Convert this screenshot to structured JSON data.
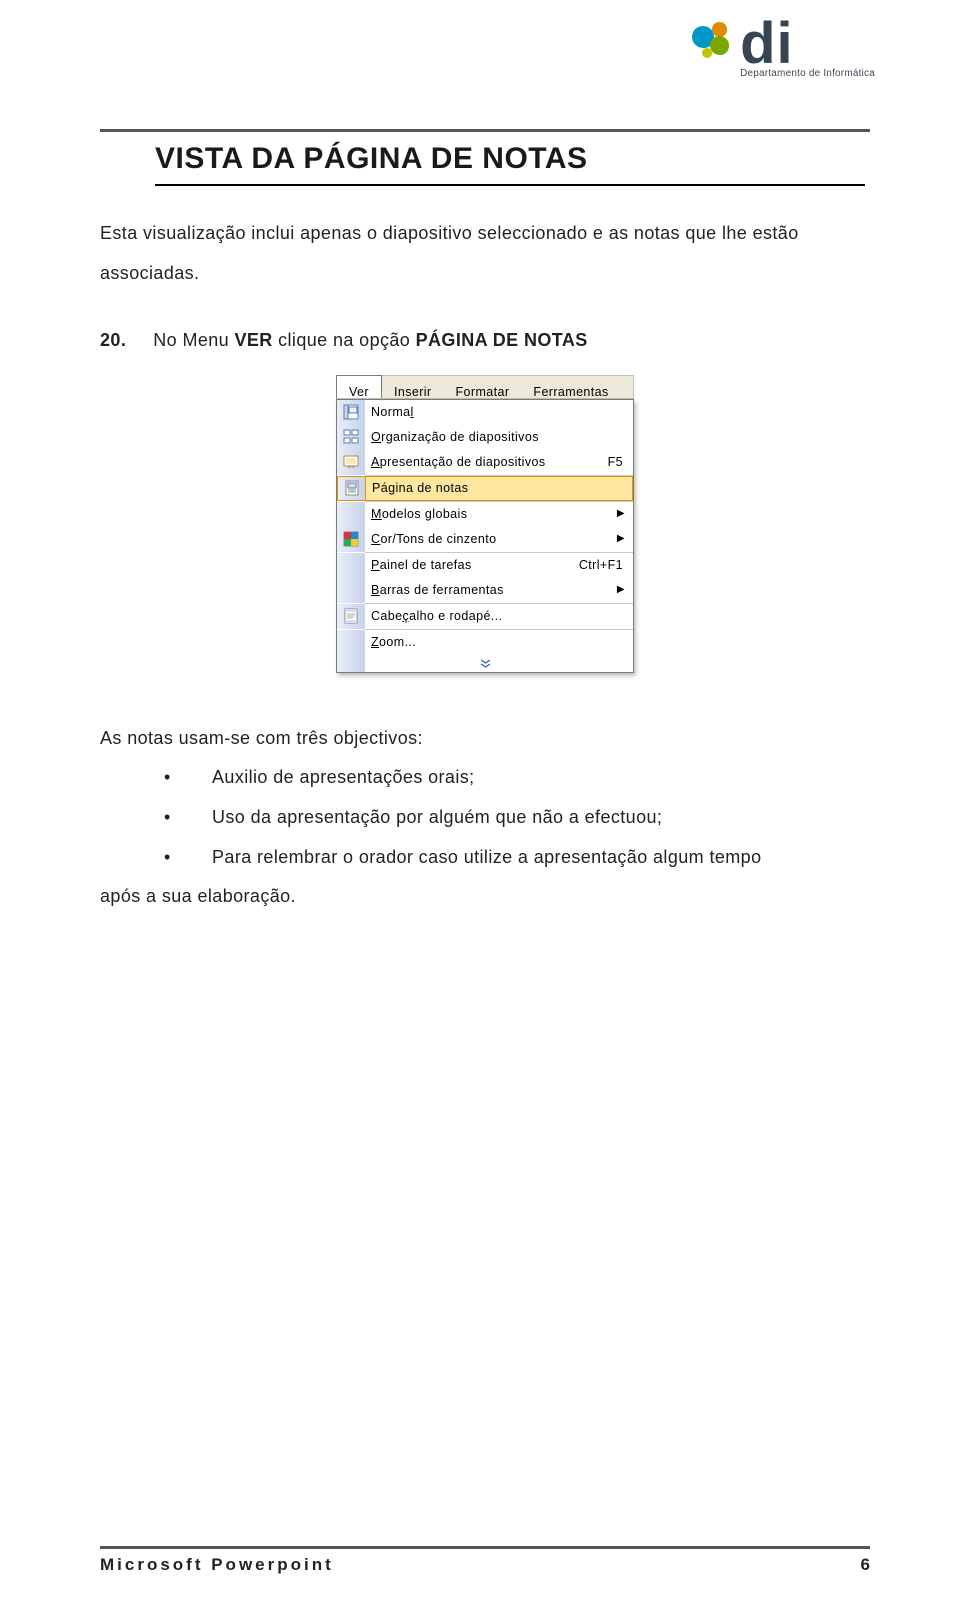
{
  "logo": {
    "text": "di",
    "sub": "Departamento de Informática"
  },
  "title": "VISTA DA PÁGINA DE NOTAS",
  "intro": "Esta visualização inclui apenas o diapositivo seleccionado e as notas que lhe estão associadas.",
  "step": {
    "num": "20.",
    "pre": "No Menu ",
    "b1": "VER",
    "mid": " clique na opção ",
    "b2": "PÁGINA DE NOTAS"
  },
  "menu": {
    "top": [
      "Ver",
      "Inserir",
      "Formatar",
      "Ferramentas"
    ],
    "items": [
      {
        "icon": "normal",
        "label": "Normal",
        "u": 5
      },
      {
        "icon": "orgslides",
        "label": "Organização de diapositivos",
        "u": 0
      },
      {
        "icon": "slideshow",
        "label": "Apresentação de diapositivos",
        "u": 0,
        "shortcut": "F5"
      },
      {
        "sep": true
      },
      {
        "icon": "notes",
        "label": "Página de notas",
        "u": 2,
        "hl": true
      },
      {
        "sep": true
      },
      {
        "label": "Modelos globais",
        "u": 0,
        "arrow": true
      },
      {
        "icon": "color",
        "label": "Cor/Tons de cinzento",
        "u": 0,
        "arrow": true
      },
      {
        "sep": true
      },
      {
        "label": "Painel de tarefas",
        "u": 0,
        "shortcut": "Ctrl+F1"
      },
      {
        "label": "Barras de ferramentas",
        "u": 0,
        "arrow": true
      },
      {
        "sep": true
      },
      {
        "icon": "headerfooter",
        "label": "Cabeçalho e rodapé...",
        "u": 4
      },
      {
        "sep": true
      },
      {
        "label": "Zoom...",
        "u": 0
      }
    ]
  },
  "list_intro": "As notas usam-se com três objectivos:",
  "bullets": [
    "Auxilio de apresentações orais;",
    "Uso da apresentação por alguém que não a efectuou;",
    "Para relembrar o orador caso utilize a apresentação algum tempo"
  ],
  "after_list": "após a sua elaboração.",
  "footer": {
    "left": "Microsoft Powerpoint",
    "page": "6"
  }
}
